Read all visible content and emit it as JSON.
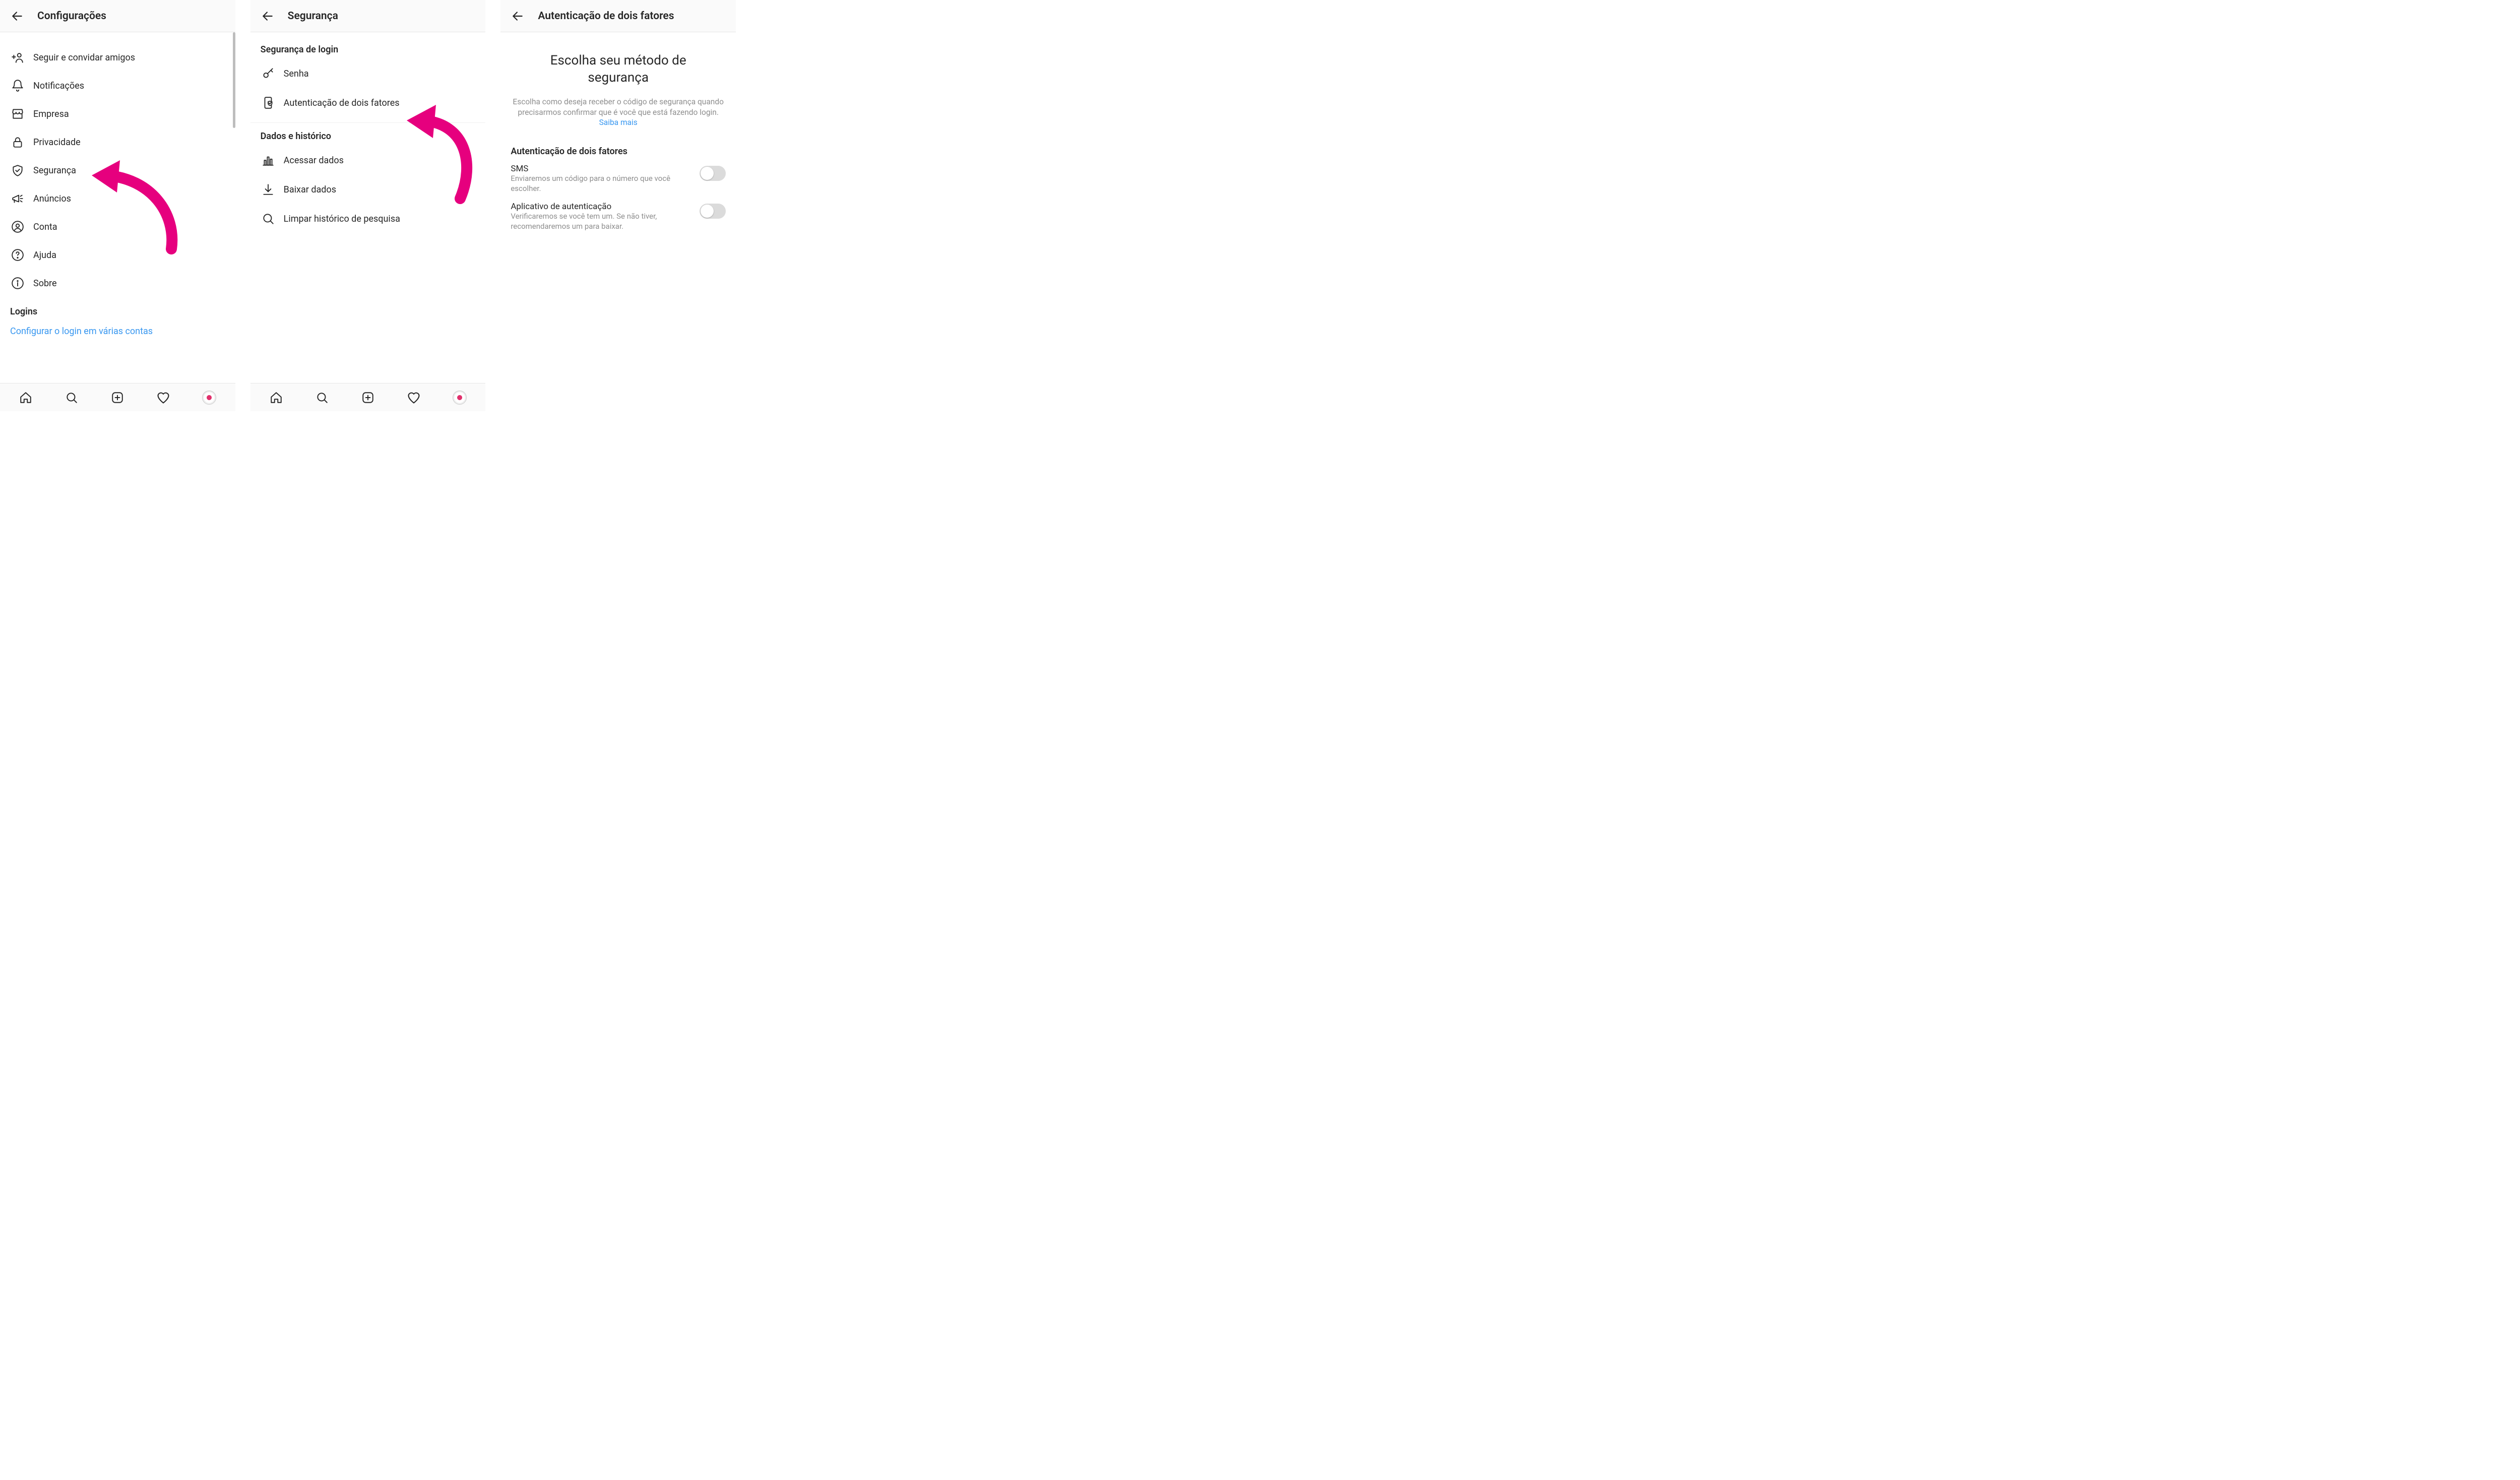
{
  "colors": {
    "accent_pink": "#e6007e",
    "link_blue": "#3897f0",
    "text_primary": "#262626",
    "text_secondary": "#8e8e8e"
  },
  "screen1": {
    "title": "Configurações",
    "items": [
      {
        "id": "follow-invite",
        "label": "Seguir e convidar amigos"
      },
      {
        "id": "notifications",
        "label": "Notificações"
      },
      {
        "id": "business",
        "label": "Empresa"
      },
      {
        "id": "privacy",
        "label": "Privacidade"
      },
      {
        "id": "security",
        "label": "Segurança"
      },
      {
        "id": "ads",
        "label": "Anúncios"
      },
      {
        "id": "account",
        "label": "Conta"
      },
      {
        "id": "help",
        "label": "Ajuda"
      },
      {
        "id": "about",
        "label": "Sobre"
      }
    ],
    "logins_section": "Logins",
    "multi_login_link": "Configurar o login em várias contas"
  },
  "screen2": {
    "title": "Segurança",
    "login_section": "Segurança de login",
    "login_items": [
      {
        "id": "password",
        "label": "Senha"
      },
      {
        "id": "two-factor",
        "label": "Autenticação de dois fatores"
      }
    ],
    "data_section": "Dados e histórico",
    "data_items": [
      {
        "id": "access-data",
        "label": "Acessar dados"
      },
      {
        "id": "download-data",
        "label": "Baixar dados"
      },
      {
        "id": "clear-search",
        "label": "Limpar histórico de pesquisa"
      }
    ]
  },
  "screen3": {
    "title": "Autenticação de dois fatores",
    "hero_line1": "Escolha seu método de",
    "hero_line2": "segurança",
    "desc": "Escolha como deseja receber o código de segurança quando precisarmos confirmar que é você que está fazendo login.",
    "learn_more": "Saiba mais",
    "section_title": "Autenticação de dois fatores",
    "sms": {
      "title": "SMS",
      "sub": "Enviaremos um código para o número que você escolher.",
      "on": false
    },
    "app": {
      "title": "Aplicativo de autenticação",
      "sub": "Verificaremos se você tem um. Se não tiver, recomendaremos um para baixar.",
      "on": false
    }
  }
}
